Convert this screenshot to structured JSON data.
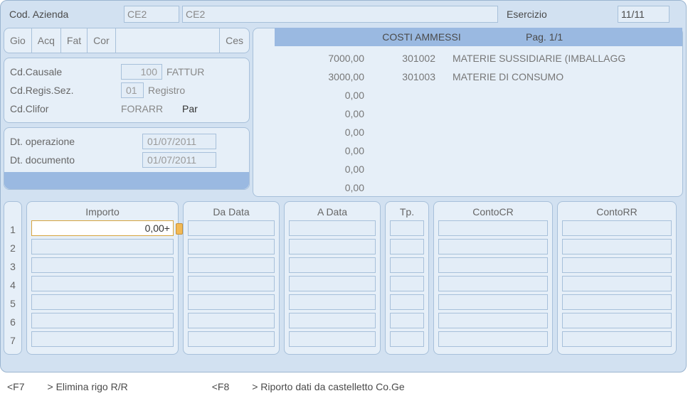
{
  "header": {
    "codAziendaLabel": "Cod. Azienda",
    "codAzienda1": "CE2",
    "codAzienda2": "CE2",
    "esercizioLabel": "Esercizio",
    "esercizio": "11/11"
  },
  "tabs": {
    "t0": "Gio",
    "t1": "Acq",
    "t2": "Fat",
    "t3": "Cor",
    "t4": "",
    "t5": "Ces"
  },
  "form": {
    "cdCausaleLbl": "Cd.Causale",
    "cdCausale": "100",
    "cdCausaleDesc": "FATTUR",
    "cdRegisLbl": "Cd.Regis.Sez.",
    "cdRegis": "01",
    "cdRegisDesc": "Registro",
    "cdCliforLbl": "Cd.Clifor",
    "cdClifor": "FORARR",
    "cdCliforDesc": "Par",
    "dtOpLbl": "Dt. operazione",
    "dtOp": "01/07/2011",
    "dtDocLbl": "Dt. documento",
    "dtDoc": "01/07/2011"
  },
  "cost": {
    "title": "COSTI AMMESSI",
    "page": "Pag. 1/1",
    "rows": [
      {
        "amt": "7000,00",
        "code": "301002",
        "desc": "MATERIE SUSSIDIARIE (IMBALLAGG"
      },
      {
        "amt": "3000,00",
        "code": "301003",
        "desc": "MATERIE DI CONSUMO"
      },
      {
        "amt": "0,00",
        "code": "",
        "desc": ""
      },
      {
        "amt": "0,00",
        "code": "",
        "desc": ""
      },
      {
        "amt": "0,00",
        "code": "",
        "desc": ""
      },
      {
        "amt": "0,00",
        "code": "",
        "desc": ""
      },
      {
        "amt": "0,00",
        "code": "",
        "desc": ""
      },
      {
        "amt": "0,00",
        "code": "",
        "desc": ""
      }
    ]
  },
  "grid": {
    "headers": {
      "importo": "Importo",
      "da": "Da Data",
      "a": "A Data",
      "tp": "Tp.",
      "cr": "ContoCR",
      "rr": "ContoRR"
    },
    "rowNums": [
      "1",
      "2",
      "3",
      "4",
      "5",
      "6",
      "7"
    ],
    "activeCell": "0,00+"
  },
  "footer": {
    "f7k": "<F7",
    "f7t": "> Elimina rigo R/R",
    "f8k": "<F8",
    "f8t": "> Riporto dati da castelletto Co.Ge"
  }
}
